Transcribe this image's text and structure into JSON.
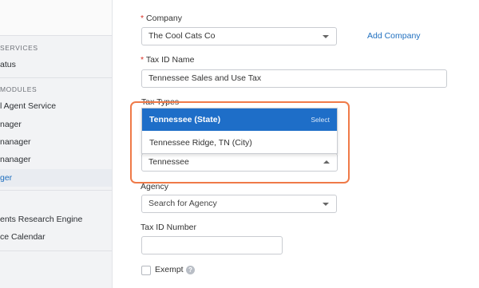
{
  "sidebar": {
    "section_services": "SERVICES",
    "status_item": "atus",
    "section_modules": "MODULES",
    "items": [
      "l Agent Service",
      "nager",
      "nanager",
      "nanager",
      "ger"
    ],
    "lower_items": [
      "ents Research Engine",
      "ce Calendar"
    ]
  },
  "form": {
    "company": {
      "required_marker": "*",
      "label": "Company",
      "value": "The Cool Cats Co",
      "add_link": "Add Company"
    },
    "tax_id_name": {
      "required_marker": "*",
      "label": "Tax ID Name",
      "value": "Tennessee Sales and Use Tax"
    },
    "tax_types": {
      "label": "Tax Types",
      "value": "Tennessee",
      "options": [
        {
          "label": "Tennessee (State)",
          "hint": "Select",
          "highlighted": true
        },
        {
          "label": "Tennessee Ridge, TN (City)",
          "highlighted": false
        }
      ]
    },
    "agency": {
      "label": "Agency",
      "placeholder": "Search for Agency"
    },
    "tax_id_number": {
      "label": "Tax ID Number",
      "value": ""
    },
    "exempt": {
      "label": "Exempt",
      "checked": false,
      "help_glyph": "?"
    }
  },
  "colors": {
    "accent": "#1e6ec8",
    "link": "#1f6fbf",
    "highlight_box": "#ef7a48",
    "required": "#d93025"
  }
}
